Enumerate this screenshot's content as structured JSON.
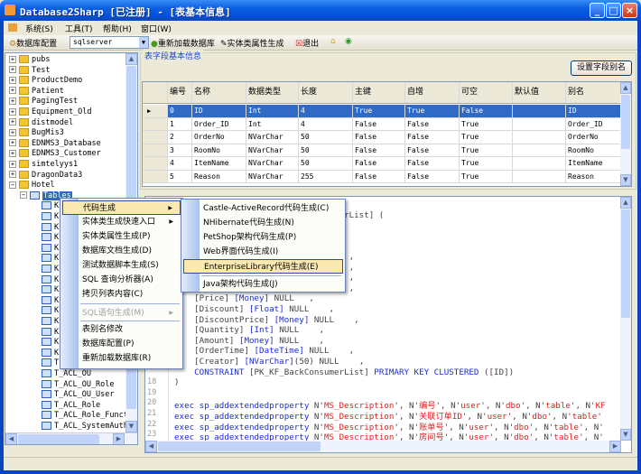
{
  "window": {
    "title": "Database2Sharp [已注册]  - [表基本信息]",
    "app_icon": "app-icon",
    "buttons": [
      "_",
      "□",
      "×"
    ]
  },
  "menubar": [
    "系统(S)",
    "工具(T)",
    "帮助(H)",
    "窗口(W)"
  ],
  "toolbar": {
    "db_config": "数据库配置",
    "db_type": "sqlserver",
    "reload": "重新加载数据库",
    "entity_props": "实体类属性生成",
    "exit": "退出"
  },
  "tree": {
    "databases": [
      "pubs",
      "Test",
      "ProductDemo",
      "Patient",
      "PagingTest",
      "Equipment_Old",
      "distmodel",
      "BugMis3",
      "EDNMS3_Database",
      "EDNMS3_Customer",
      "simtelyys1",
      "DragonData3",
      "Hotel"
    ],
    "tables_node": "Tables",
    "tables": [
      "K",
      "K",
      "K",
      "K",
      "K",
      "K",
      "K",
      "K",
      "K",
      "K",
      "K",
      "K",
      "K",
      "K",
      "K",
      "T",
      "T_ACL_OU",
      "T_ACL_OU_Role",
      "T_ACL_OU_User",
      "T_ACL_Role",
      "T_ACL_Role_Funct:",
      "T_ACL_SystemAuth",
      "T_ACL_SystemType"
    ]
  },
  "fields_panel": {
    "title": "表字段基本信息",
    "alias_button": "设置字段别名",
    "columns": [
      "编号",
      "名称",
      "数据类型",
      "长度",
      "主键",
      "自增",
      "可空",
      "默认值",
      "别名"
    ],
    "rows": [
      [
        "0",
        "ID",
        "Int",
        "4",
        "True",
        "True",
        "False",
        "",
        "ID"
      ],
      [
        "1",
        "Order_ID",
        "Int",
        "4",
        "False",
        "False",
        "True",
        "",
        "Order_ID"
      ],
      [
        "2",
        "OrderNo",
        "NVarChar",
        "50",
        "False",
        "False",
        "True",
        "",
        "OrderNo"
      ],
      [
        "3",
        "RoomNo",
        "NVarChar",
        "50",
        "False",
        "False",
        "True",
        "",
        "RoomNo"
      ],
      [
        "4",
        "ItemName",
        "NVarChar",
        "50",
        "False",
        "False",
        "True",
        "",
        "ItemName"
      ],
      [
        "5",
        "Reason",
        "NVarChar",
        "255",
        "False",
        "False",
        "True",
        "",
        "Reason"
      ]
    ],
    "selected_row": 0
  },
  "editor": {
    "lines": [
      {
        "n": "",
        "parts": [
          [
            "pl",
            ""
          ]
        ]
      },
      {
        "n": "",
        "parts": [
          [
            "pl",
            "CREATE TABLE [dbo].[KF_BackConsumerList] ("
          ]
        ]
      },
      {
        "n": "",
        "parts": [
          [
            "pl",
            ""
          ]
        ]
      },
      {
        "n": "",
        "parts": [
          [
            "pl",
            "    [ID] [Int] IDENTITY (1, 1)  ,"
          ]
        ]
      },
      {
        "n": "",
        "parts": [
          [
            "pl",
            "    [Order_ID] [Int] NULL   ,"
          ]
        ]
      },
      {
        "n": "",
        "parts": [
          [
            "pl",
            "    [OrderNo] [NVarChar](50) NULL  ,"
          ]
        ]
      },
      {
        "n": "",
        "parts": [
          [
            "pl",
            "    [RoomNo] [NVarChar](50) NULL   ,"
          ]
        ]
      },
      {
        "n": "",
        "parts": [
          [
            "pl",
            "    [ItemName] [NVarChar](50) NULL ,"
          ]
        ]
      },
      {
        "n": "",
        "parts": [
          [
            "pl",
            "    [Reason] [NVarChar](255) NULL  ,"
          ]
        ]
      },
      {
        "n": "",
        "parts": [
          [
            "pl",
            "    [Price] "
          ],
          [
            "kw",
            "[Money]"
          ],
          [
            "pl",
            " NULL   ,"
          ]
        ]
      },
      {
        "n": "",
        "parts": [
          [
            "pl",
            "    [Discount] "
          ],
          [
            "kw",
            "[Float]"
          ],
          [
            "pl",
            " NULL    ,"
          ]
        ]
      },
      {
        "n": "",
        "parts": [
          [
            "pl",
            "    [DiscountPrice] "
          ],
          [
            "kw",
            "[Money]"
          ],
          [
            "pl",
            " NULL    ,"
          ]
        ]
      },
      {
        "n": "",
        "parts": [
          [
            "pl",
            "    [Quantity] "
          ],
          [
            "kw",
            "[Int]"
          ],
          [
            "pl",
            " NULL    ,"
          ]
        ]
      },
      {
        "n": "",
        "parts": [
          [
            "pl",
            "    [Amount] "
          ],
          [
            "kw",
            "[Money]"
          ],
          [
            "pl",
            " NULL    ,"
          ]
        ]
      },
      {
        "n": "",
        "parts": [
          [
            "pl",
            "    [OrderTime] "
          ],
          [
            "kw",
            "[DateTime]"
          ],
          [
            "pl",
            " NULL    ,"
          ]
        ]
      },
      {
        "n": "",
        "parts": [
          [
            "pl",
            "    [Creator] "
          ],
          [
            "kw",
            "[NVarChar]"
          ],
          [
            "pl",
            "(50) NULL    ,"
          ]
        ]
      },
      {
        "n": "",
        "parts": [
          [
            "kw",
            "    CONSTRAINT"
          ],
          [
            "pl",
            " [PK_KF_BackConsumerList] "
          ],
          [
            "kw",
            "PRIMARY KEY CLUSTERED"
          ],
          [
            "pl",
            " ([ID])"
          ]
        ]
      },
      {
        "n": "18",
        "parts": [
          [
            "pl",
            ")"
          ]
        ]
      },
      {
        "n": "19",
        "parts": [
          [
            "pl",
            ""
          ]
        ]
      },
      {
        "n": "20",
        "parts": [
          [
            "kw",
            "exec sp_addextendedproperty"
          ],
          [
            "pl",
            " N'"
          ],
          [
            "str",
            "MS_Description"
          ],
          [
            "pl",
            "', N'"
          ],
          [
            "str",
            "编号"
          ],
          [
            "pl",
            "', N'"
          ],
          [
            "str",
            "user"
          ],
          [
            "pl",
            "', N'"
          ],
          [
            "str",
            "dbo"
          ],
          [
            "pl",
            "', N'"
          ],
          [
            "str",
            "table"
          ],
          [
            "pl",
            "', N'"
          ],
          [
            "str",
            "KF"
          ]
        ]
      },
      {
        "n": "21",
        "parts": [
          [
            "kw",
            "exec sp_addextendedproperty"
          ],
          [
            "pl",
            " N'"
          ],
          [
            "str",
            "MS_Description"
          ],
          [
            "pl",
            "', N'"
          ],
          [
            "str",
            "关联订单ID"
          ],
          [
            "pl",
            "', N'"
          ],
          [
            "str",
            "user"
          ],
          [
            "pl",
            "', N'"
          ],
          [
            "str",
            "dbo"
          ],
          [
            "pl",
            "', N'"
          ],
          [
            "str",
            "table"
          ],
          [
            "pl",
            "'"
          ]
        ]
      },
      {
        "n": "22",
        "parts": [
          [
            "kw",
            "exec sp_addextendedproperty"
          ],
          [
            "pl",
            " N'"
          ],
          [
            "str",
            "MS_Description"
          ],
          [
            "pl",
            "', N'"
          ],
          [
            "str",
            "账单号"
          ],
          [
            "pl",
            "', N'"
          ],
          [
            "str",
            "user"
          ],
          [
            "pl",
            "', N'"
          ],
          [
            "str",
            "dbo"
          ],
          [
            "pl",
            "', N'"
          ],
          [
            "str",
            "table"
          ],
          [
            "pl",
            "', N'"
          ]
        ]
      },
      {
        "n": "23",
        "parts": [
          [
            "kw",
            "exec sp_addextendedproperty"
          ],
          [
            "pl",
            " N'"
          ],
          [
            "str",
            "MS_Description"
          ],
          [
            "pl",
            "', N'"
          ],
          [
            "str",
            "房间号"
          ],
          [
            "pl",
            "', N'"
          ],
          [
            "str",
            "user"
          ],
          [
            "pl",
            "', N'"
          ],
          [
            "str",
            "dbo"
          ],
          [
            "pl",
            "', N'"
          ],
          [
            "str",
            "table"
          ],
          [
            "pl",
            "', N'"
          ]
        ]
      },
      {
        "n": "24",
        "parts": [
          [
            "kw",
            "exec sp_addextendedproperty"
          ],
          [
            "pl",
            " N'"
          ],
          [
            "str",
            "MS_Description"
          ],
          [
            "pl",
            "', N'"
          ],
          [
            "str",
            "项目名称"
          ],
          [
            "pl",
            "', N'"
          ],
          [
            "str",
            "user"
          ],
          [
            "pl",
            "', N'"
          ],
          [
            "str",
            "dbo"
          ],
          [
            "pl",
            "', N'"
          ],
          [
            "str",
            "table"
          ],
          [
            "pl",
            "',"
          ]
        ]
      }
    ]
  },
  "context_menu": {
    "items": [
      {
        "label": "代码生成",
        "submenu": true,
        "highlight": true
      },
      {
        "label": "实体类生成快速入口",
        "submenu": true
      },
      {
        "label": "实体类属性生成(P)"
      },
      {
        "label": "数据库文档生成(D)"
      },
      {
        "label": "测试数据脚本生成(S)"
      },
      {
        "label": "SQL 查询分析器(A)"
      },
      {
        "label": "拷贝列表内容(C)"
      },
      {
        "label": "SQL语句生成(M)",
        "submenu": true,
        "disabled": true
      },
      {
        "label": "表别名修改"
      },
      {
        "label": "数据库配置(P)"
      },
      {
        "label": "重新加载数据库(R)"
      }
    ]
  },
  "submenu": {
    "items": [
      {
        "label": "Castle-ActiveRecord代码生成(C)"
      },
      {
        "label": "NHibernate代码生成(N)"
      },
      {
        "label": "PetShop架构代码生成(P)"
      },
      {
        "label": "Web界面代码生成(I)"
      },
      {
        "label": "EnterpriseLibrary代码生成(E)",
        "highlight": true
      },
      {
        "label": "Java架构代码生成(J)"
      }
    ]
  },
  "colors": {
    "title_bar": "#0a5fe0",
    "selection": "#316ac5",
    "menu_highlight": "#fbe9b2",
    "keyword": "#1a2bd8",
    "string": "#e02020"
  }
}
